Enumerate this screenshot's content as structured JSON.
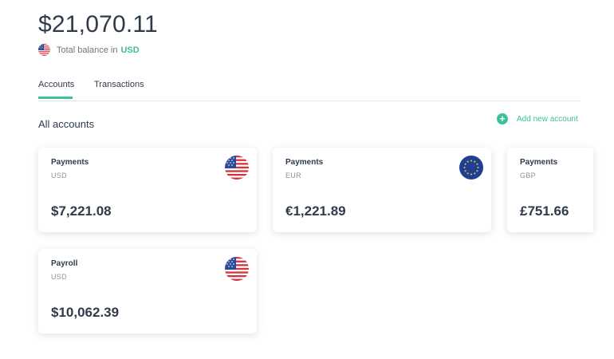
{
  "summary": {
    "total_balance": "$21,070.11",
    "label": "Total balance in",
    "currency": "USD"
  },
  "tabs": [
    {
      "label": "Accounts",
      "active": true
    },
    {
      "label": "Transactions",
      "active": false
    }
  ],
  "section": {
    "title": "All accounts",
    "add_label": "Add new account"
  },
  "accounts": [
    {
      "name": "Payments",
      "currency": "USD",
      "balance": "$7,221.08",
      "flag": "us-flag-icon"
    },
    {
      "name": "Payments",
      "currency": "EUR",
      "balance": "€1,221.89",
      "flag": "eu-flag-icon"
    },
    {
      "name": "Payments",
      "currency": "GBP",
      "balance": "£751.66",
      "flag": "gb-flag-icon"
    },
    {
      "name": "Payroll",
      "currency": "USD",
      "balance": "$10,062.39",
      "flag": "us-flag-icon"
    }
  ],
  "colors": {
    "accent": "#3dbf9a",
    "text": "#2f3b4a",
    "muted": "#8b94a0",
    "eu_blue": "#1f3f93",
    "us_red": "#d2333c",
    "us_blue": "#2c4a9a"
  }
}
